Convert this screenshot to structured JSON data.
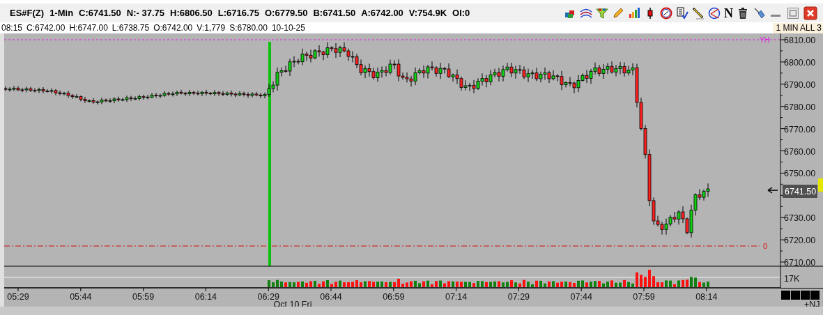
{
  "header": {
    "fields": [
      "ES#F(Z)",
      "1-Min",
      "C:6741.50",
      "N:- 37.75",
      "H:6806.50",
      "L:6716.75",
      "O:6779.50",
      "B:6741.50",
      "A:6742.00",
      "V:754.9K",
      "OI:0"
    ],
    "toolbar_letter": "N"
  },
  "info_row": {
    "fields": [
      "08:15",
      "C:6742.00",
      "H:6747.00",
      "L:6738.75",
      "O:6742.00",
      "V:1,779",
      "S:6780.00",
      "10-10-25"
    ],
    "scale_label": "1 MIN ALL 3"
  },
  "chart": {
    "price_labels_upper": [
      "6810.00",
      "6800.00",
      "6790.00",
      "6780.00",
      "6770.00",
      "6760.00",
      "6750.00"
    ],
    "price_labels_lower": [
      "6730.00",
      "6720.00",
      "6710.00"
    ],
    "last_price": "6741.50",
    "yesterday_high_label": "YH",
    "zero_line_label": "0",
    "volume_label": "17K",
    "time_labels": [
      "05:29",
      "05:44",
      "05:59",
      "06:14",
      "06:29",
      "06:44",
      "06:59",
      "07:14",
      "07:29",
      "07:44",
      "07:59",
      "08:14"
    ],
    "date_label": "Oct 10 Fri",
    "corner_label": "+NJ"
  }
}
